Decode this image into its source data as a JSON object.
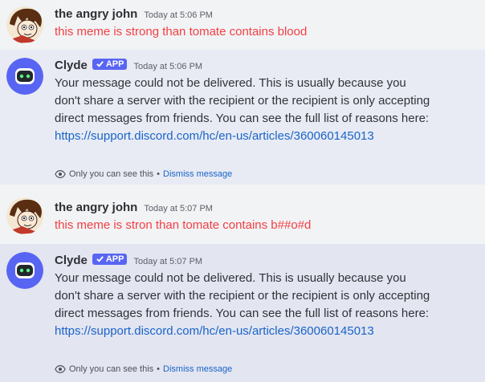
{
  "messages": [
    {
      "author": "the angry john",
      "timestamp": "Today at 5:06 PM",
      "text": "this meme is strong than tomate contains blood",
      "avatar_icon": "cartoon-character-avatar"
    },
    {
      "author": "Clyde",
      "tag_label": "APP",
      "timestamp": "Today at 5:06 PM",
      "text_before_link": "Your message could not be delivered. This is usually because you don't share a server with the recipient or the recipient is only accepting direct messages from friends. You can see the full list of reasons here: ",
      "link_text": "https://support.discord.com/hc/en-us/articles/360060145013",
      "ephemeral_notice": "Only you can see this",
      "separator": "•",
      "dismiss_label": "Dismiss message",
      "avatar_icon": "clyde-bot-avatar"
    },
    {
      "author": "the angry john",
      "timestamp": "Today at 5:07 PM",
      "text": "this meme is stron than tomate contains b##o#d",
      "avatar_icon": "cartoon-character-avatar"
    },
    {
      "author": "Clyde",
      "tag_label": "APP",
      "timestamp": "Today at 5:07 PM",
      "text_before_link": "Your message could not be delivered. This is usually because you don't share a server with the recipient or the recipient is only accepting direct messages from friends. You can see the full list of reasons here: ",
      "link_text": "https://support.discord.com/hc/en-us/articles/360060145013",
      "ephemeral_notice": "Only you can see this",
      "separator": "•",
      "dismiss_label": "Dismiss message",
      "avatar_icon": "clyde-bot-avatar"
    }
  ],
  "colors": {
    "background": "#f2f3f5",
    "system_background": "#e8ebf4",
    "red_text": "#f23f43",
    "link": "#1a64c8",
    "app_tag": "#5865f2",
    "clyde_avatar": "#5865f2"
  }
}
